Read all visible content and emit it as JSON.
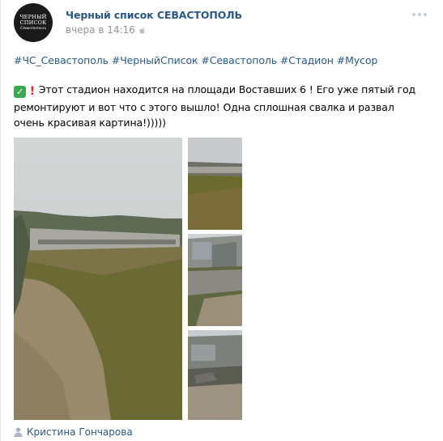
{
  "post": {
    "avatar": {
      "line1": "ЧЕРНЫЙ",
      "line2": "СПИСОК",
      "line3": "Севастополь"
    },
    "author": "Черный список СЕВАСТОПОЛЬ",
    "time": "вчера в 14:16",
    "platform_icon": "apple-icon",
    "hashtags": "#ЧС_Севастополь #ЧерныйСписок #Севастополь #Стадион #Мусор",
    "text": "Этот стадион находится на площади Воставших 6 ! Его уже пятый год ремонтируют и вот что с этого вышло! Одна сплошная свалка и развал очень красивая картина!)))))",
    "emoji": [
      "check-mark-icon",
      "exclamation-icon"
    ],
    "photos": [
      {
        "id": "photo-main"
      },
      {
        "id": "photo-thumb-1"
      },
      {
        "id": "photo-thumb-2"
      },
      {
        "id": "photo-thumb-3"
      }
    ],
    "signer": "Кристина Гончарова"
  },
  "colors": {
    "link": "#2a5885",
    "meta": "#939393",
    "dots": "#c5d0db",
    "check": "#3aa853",
    "exclamation": "#e02a2a"
  }
}
